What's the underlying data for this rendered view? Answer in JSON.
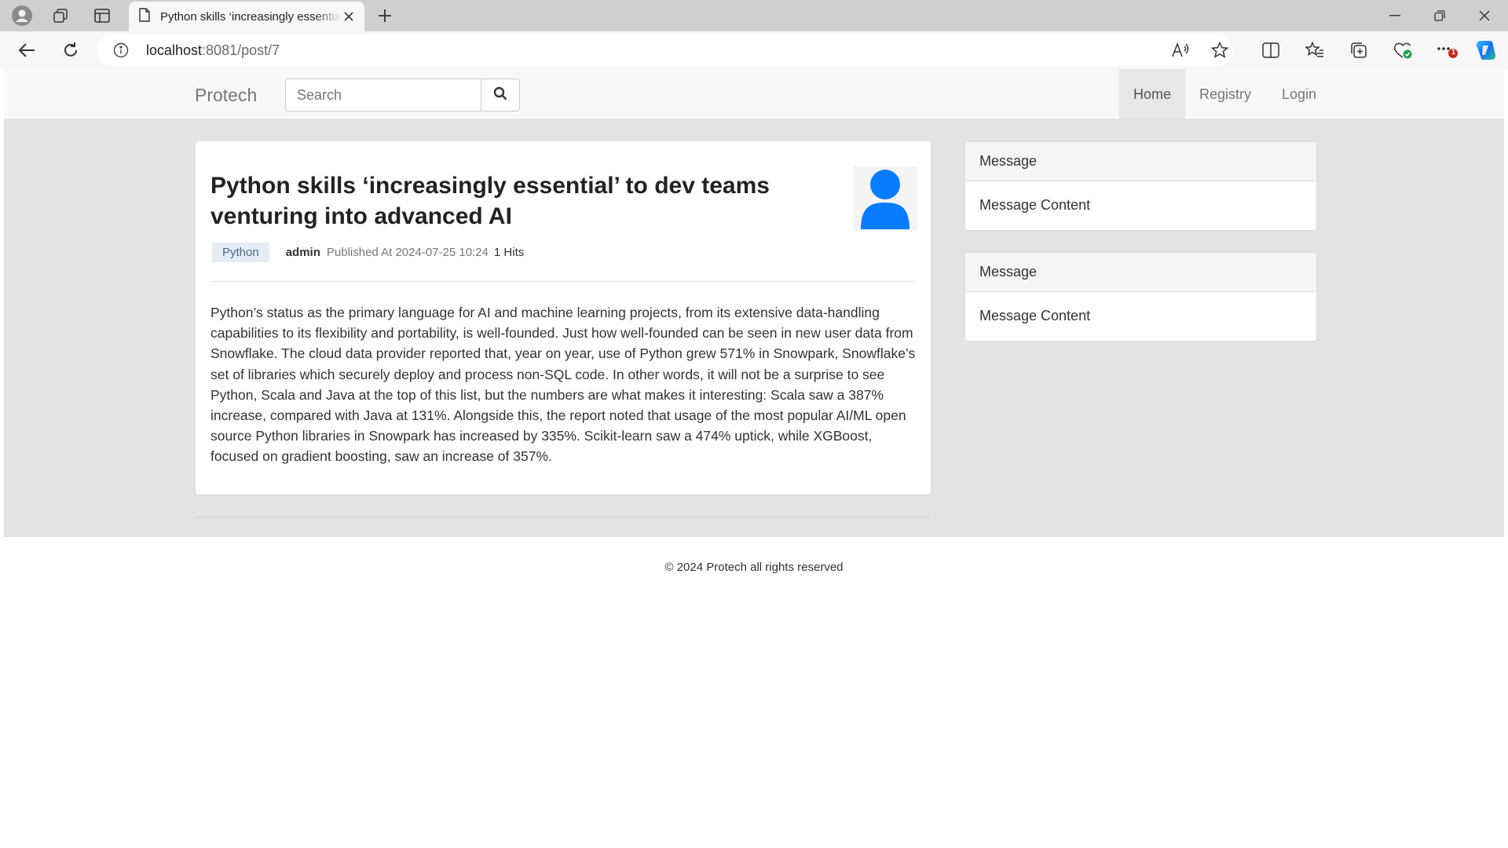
{
  "browser": {
    "tab_title": "Python skills ‘increasingly essential’ to dev teams venturing into advanced AI",
    "url_host": "localhost",
    "url_rest": ":8081/post/7",
    "notification_badge": "1"
  },
  "site": {
    "brand": "Protech",
    "search_placeholder": "Search",
    "nav": {
      "home": "Home",
      "registry": "Registry",
      "login": "Login"
    }
  },
  "post": {
    "title": "Python skills ‘increasingly essential’ to dev teams venturing into advanced AI",
    "tag": "Python",
    "author": "admin",
    "published": "Published At 2024-07-25 10:24",
    "hits": "1 Hits",
    "body": "Python’s status as the primary language for AI and machine learning projects, from its extensive data-handling capabilities to its flexibility and portability, is well-founded. Just how well-founded can be seen in new user data from Snowflake. The cloud data provider reported that, year on year, use of Python grew 571% in Snowpark, Snowflake’s set of libraries which securely deploy and process non-SQL code. In other words, it will not be a surprise to see Python, Scala and Java at the top of this list, but the numbers are what makes it interesting: Scala saw a 387% increase, compared with Java at 131%. Alongside this, the report noted that usage of the most popular AI/ML open source Python libraries in Snowpark has increased by 335%. Scikit-learn saw a 474% uptick, while XGBoost, focused on gradient boosting, saw an increase of 357%."
  },
  "sidebar": {
    "messages": [
      {
        "title": "Message",
        "content": "Message Content"
      },
      {
        "title": "Message",
        "content": "Message Content"
      }
    ]
  },
  "footer": {
    "text": "© 2024 Protech all rights reserved"
  },
  "colors": {
    "avatar_blue": "#0a7cff",
    "content_bg": "#e3e3e3",
    "navbar_bg": "#f8f8f8"
  }
}
